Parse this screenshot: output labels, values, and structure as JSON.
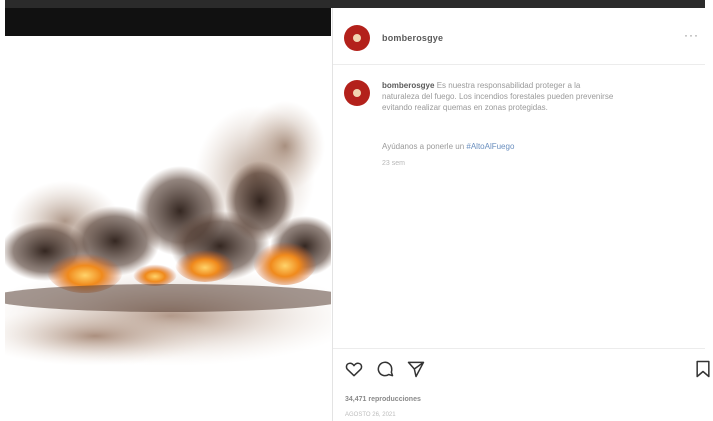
{
  "post": {
    "username": "bomberosgye",
    "more_label": "···",
    "caption": {
      "username": "bomberosgye",
      "text_line1": "Es nuestra responsabilidad proteger a la",
      "text_line2": "naturaleza del fuego. Los incendios forestales pueden prevenirse",
      "text_line3": "evitando realizar quemas en zonas protegidas."
    },
    "help_text": "Ayúdanos a ponerle un",
    "hashtag": "#AltoAlFuego",
    "time_ago": "23 sem",
    "views": "34,471 reproducciones",
    "date": "AGOSTO 26, 2021"
  },
  "icons": {
    "like": "heart-icon",
    "comment": "comment-icon",
    "share": "share-icon",
    "save": "bookmark-icon"
  },
  "colors": {
    "avatar": "#b3211b",
    "hashtag": "#6a8fbf",
    "fire": "#f08a1c",
    "smoke": "#3a2a22"
  }
}
